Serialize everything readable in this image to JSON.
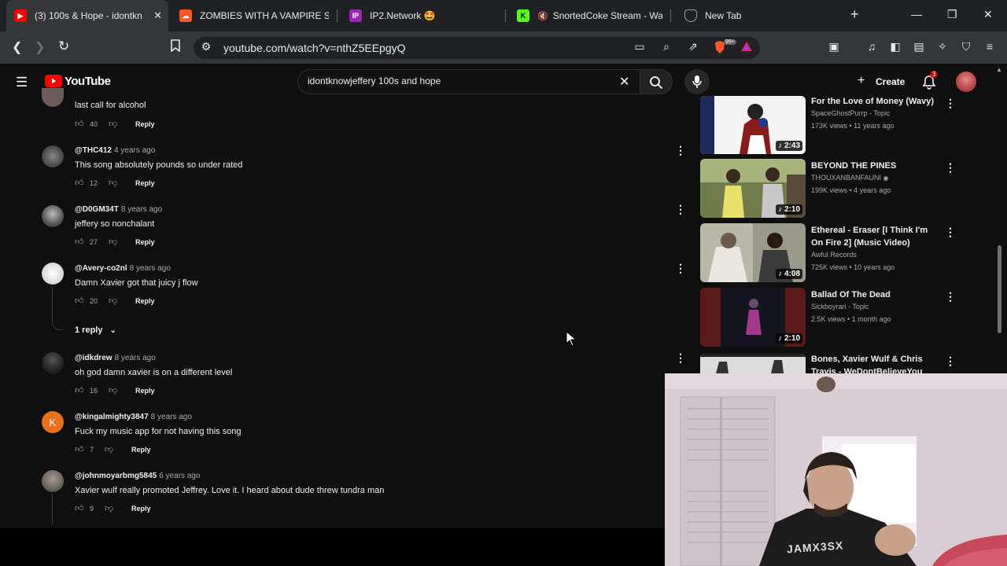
{
  "browser": {
    "tabs": [
      {
        "title": "(3) 100s & Hope - idontkn",
        "favicon_color": "#ff0000",
        "active": true
      },
      {
        "title": "ZOMBIES WITH A VAMPIRE SP",
        "favicon_color": "#ff5722",
        "active": false
      },
      {
        "title": "IP2.Network 🤩",
        "favicon_color": "#9c27b0",
        "active": false
      },
      {
        "title": "SnortedCoke Stream - Wat",
        "favicon_color": "#53fc18",
        "active": false
      },
      {
        "title": "New Tab",
        "favicon_color": "#9aa0a6",
        "active": false
      }
    ],
    "new_tab_label": "+",
    "url": "youtube.com/watch?v=nthZ5EEpgyQ",
    "extension_badge": "99+"
  },
  "youtube": {
    "logo_text": "YouTube",
    "search_value": "idontknowjeffery 100s and hope",
    "create_label": "Create",
    "notification_count": "3"
  },
  "comments": [
    {
      "author": "",
      "ago": "",
      "text": "last call for alcohol",
      "likes": "40",
      "reply_label": "Reply",
      "avatar_color": "#6b5b5b"
    },
    {
      "author": "@THC412",
      "ago": "4 years ago",
      "text": "This song absolutely pounds so under rated",
      "likes": "12",
      "reply_label": "Reply",
      "avatar_color": "#555"
    },
    {
      "author": "@D0GM34T",
      "ago": "8 years ago",
      "text": "jeffery so nonchalant",
      "likes": "27",
      "reply_label": "Reply",
      "avatar_color": "#777"
    },
    {
      "author": "@Avery-co2nl",
      "ago": "8 years ago",
      "text": "Damn Xavier got that juicy j flow",
      "likes": "20",
      "reply_label": "Reply",
      "avatar_color": "#e0e0e0"
    },
    {
      "author": "@idkdrew",
      "ago": "8 years ago",
      "text": "oh god damn xavier is on a different level",
      "likes": "16",
      "reply_label": "Reply",
      "avatar_color": "#333"
    },
    {
      "author": "@kingalmighty3847",
      "ago": "8 years ago",
      "text": "Fuck my music app for not having this song",
      "likes": "7",
      "reply_label": "Reply",
      "avatar_color": "#e8711a",
      "avatar_letter": "K"
    },
    {
      "author": "@johnmoyarbmg5845",
      "ago": "6 years ago",
      "text": "Xavier wulf really promoted Jeffrey. Love it. I heard about dude threw tundra man",
      "likes": "9",
      "reply_label": "Reply",
      "avatar_color": "#7a6a5a"
    }
  ],
  "replies_toggle": "1 reply",
  "recommendations": [
    {
      "title": "For the Love of Money (Wavy)",
      "channel": "SpaceGhostPurrp - Topic",
      "meta": "173K views • 11 years ago",
      "duration": "2:43",
      "thumb_color": "#2a2a3a"
    },
    {
      "title": "BEYOND THE PINES",
      "channel": "THOUXANBANFAUNI",
      "meta": "199K views • 4 years ago",
      "duration": "2:10",
      "thumb_color": "#4a5a3a"
    },
    {
      "title": "Ethereal - Eraser [I Think I'm On Fire 2] (Music Video)",
      "channel": "Awful Records",
      "meta": "725K views • 10 years ago",
      "duration": "4:08",
      "thumb_color": "#8a8a7a"
    },
    {
      "title": "Ballad Of The Dead",
      "channel": "Sickboyrari - Topic",
      "meta": "2.5K views • 1 month ago",
      "duration": "2:10",
      "thumb_color": "#1a1a2a"
    },
    {
      "title": "Bones, Xavier Wulf & Chris Travis - WeDontBelieveYou",
      "channel": "",
      "meta": "",
      "duration": "",
      "thumb_color": "#ddd"
    }
  ],
  "webcam": {
    "shirt_text": "JAMX3SX"
  }
}
